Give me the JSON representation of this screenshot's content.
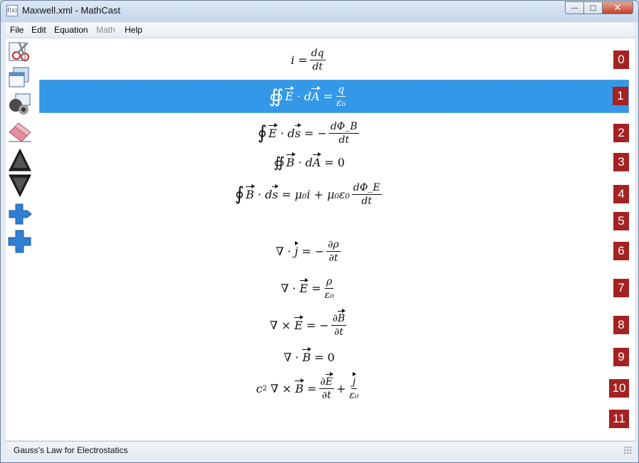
{
  "window": {
    "title": "Maxwell.xml - MathCast",
    "icon": "formula-doc-icon"
  },
  "menu": [
    "File",
    "Edit",
    "Equation",
    "Math",
    "Help"
  ],
  "menu_disabled": [
    "Math"
  ],
  "toolbar": [
    {
      "icon": "scissors-cut-icon"
    },
    {
      "icon": "copy-icon"
    },
    {
      "icon": "paste-icon"
    },
    {
      "icon": "eraser-icon"
    },
    {
      "icon": "move-up-triangle-icon"
    },
    {
      "icon": "move-down-triangle-icon"
    },
    {
      "icon": "insert-after-icon"
    },
    {
      "icon": "add-plus-icon"
    }
  ],
  "equations": [
    {
      "number": "0",
      "id": "eq-0"
    },
    {
      "number": "1",
      "id": "eq-1",
      "selected": true
    },
    {
      "number": "2",
      "id": "eq-2"
    },
    {
      "number": "3",
      "id": "eq-3"
    },
    {
      "number": "4",
      "id": "eq-4"
    },
    {
      "number": "5",
      "id": "eq-5"
    },
    {
      "number": "6",
      "id": "eq-6"
    },
    {
      "number": "7",
      "id": "eq-7"
    },
    {
      "number": "8",
      "id": "eq-8"
    },
    {
      "number": "9",
      "id": "eq-9"
    },
    {
      "number": "10",
      "id": "eq-10"
    },
    {
      "number": "11",
      "id": "eq-11"
    }
  ],
  "eq_text": {
    "i": "i",
    "eq": "=",
    "dq": "dq",
    "dt": "dt",
    "q": "q",
    "eps0": "ε₀",
    "E": "E",
    "A": "A",
    "s": "s",
    "B": "B",
    "j": "j",
    "dPhiB": "dΦ_B",
    "dPhiE": "dΦ_E",
    "mu0": "μ₀",
    "nabla": "∇",
    "rho": "ρ",
    "partial": "∂",
    "zero": "0"
  },
  "status": {
    "text": "Gauss's Law for Electrostatics"
  },
  "colors": {
    "selection": "#3398e8",
    "badge": "#a52222"
  }
}
